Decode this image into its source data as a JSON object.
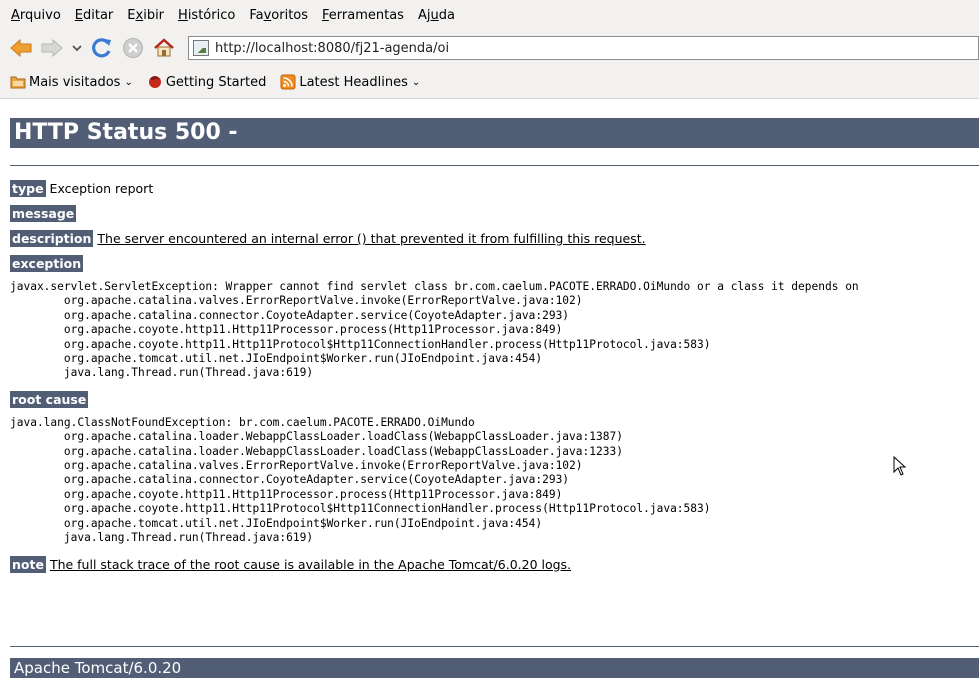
{
  "menu": [
    {
      "pre": "",
      "key": "A",
      "post": "rquivo"
    },
    {
      "pre": "",
      "key": "E",
      "post": "ditar"
    },
    {
      "pre": "E",
      "key": "x",
      "post": "ibir"
    },
    {
      "pre": "",
      "key": "H",
      "post": "istórico"
    },
    {
      "pre": "Fa",
      "key": "v",
      "post": "oritos"
    },
    {
      "pre": "",
      "key": "F",
      "post": "erramentas"
    },
    {
      "pre": "Aj",
      "key": "u",
      "post": "da"
    }
  ],
  "nav": {
    "url": "http://localhost:8080/fj21-agenda/oi",
    "icons": [
      "back-arrow-icon",
      "forward-arrow-icon",
      "history-dropdown-icon",
      "reload-icon",
      "stop-icon",
      "home-icon",
      "site-favicon-icon"
    ]
  },
  "bookmarks": [
    {
      "label": "Mais visitados",
      "icon": "folder-icon",
      "dropdown": true
    },
    {
      "label": "Getting Started",
      "icon": "firefox-icon",
      "dropdown": false
    },
    {
      "label": "Latest Headlines",
      "icon": "rss-feed-icon",
      "dropdown": true
    }
  ],
  "page": {
    "title": "HTTP Status 500 -",
    "type_label": "type",
    "type_value": "Exception report",
    "message_label": "message",
    "description_label": "description",
    "description_value": "The server encountered an internal error () that prevented it from fulfilling this request.",
    "exception_label": "exception",
    "exception_trace": [
      "javax.servlet.ServletException: Wrapper cannot find servlet class br.com.caelum.PACOTE.ERRADO.OiMundo or a class it depends on",
      "\torg.apache.catalina.valves.ErrorReportValve.invoke(ErrorReportValve.java:102)",
      "\torg.apache.catalina.connector.CoyoteAdapter.service(CoyoteAdapter.java:293)",
      "\torg.apache.coyote.http11.Http11Processor.process(Http11Processor.java:849)",
      "\torg.apache.coyote.http11.Http11Protocol$Http11ConnectionHandler.process(Http11Protocol.java:583)",
      "\torg.apache.tomcat.util.net.JIoEndpoint$Worker.run(JIoEndpoint.java:454)",
      "\tjava.lang.Thread.run(Thread.java:619)"
    ],
    "root_cause_label": "root cause",
    "root_cause_trace": [
      "java.lang.ClassNotFoundException: br.com.caelum.PACOTE.ERRADO.OiMundo",
      "\torg.apache.catalina.loader.WebappClassLoader.loadClass(WebappClassLoader.java:1387)",
      "\torg.apache.catalina.loader.WebappClassLoader.loadClass(WebappClassLoader.java:1233)",
      "\torg.apache.catalina.valves.ErrorReportValve.invoke(ErrorReportValve.java:102)",
      "\torg.apache.catalina.connector.CoyoteAdapter.service(CoyoteAdapter.java:293)",
      "\torg.apache.coyote.http11.Http11Processor.process(Http11Processor.java:849)",
      "\torg.apache.coyote.http11.Http11Protocol$Http11ConnectionHandler.process(Http11Protocol.java:583)",
      "\torg.apache.tomcat.util.net.JIoEndpoint$Worker.run(JIoEndpoint.java:454)",
      "\tjava.lang.Thread.run(Thread.java:619)"
    ],
    "note_label": "note",
    "note_value": "The full stack trace of the root cause is available in the Apache Tomcat/6.0.20 logs.",
    "footer": "Apache Tomcat/6.0.20"
  },
  "colors": {
    "heading_bg": "#525d76",
    "chrome_bg": "#f2f1f0"
  }
}
